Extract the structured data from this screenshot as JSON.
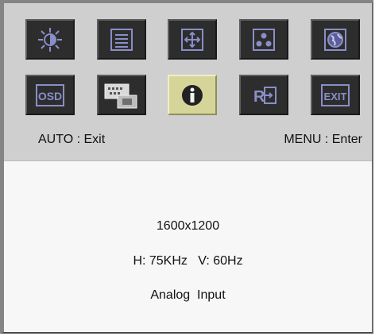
{
  "osd_menu": {
    "icons_row1": [
      {
        "name": "brightness-contrast-icon"
      },
      {
        "name": "list-menu-icon"
      },
      {
        "name": "position-move-icon"
      },
      {
        "name": "color-dots-icon"
      },
      {
        "name": "globe-language-icon"
      }
    ],
    "icons_row2": [
      {
        "name": "osd-settings-icon",
        "label": "OSD"
      },
      {
        "name": "input-signal-icon"
      },
      {
        "name": "information-icon",
        "selected": true
      },
      {
        "name": "reset-recall-icon",
        "label": "R"
      },
      {
        "name": "exit-icon",
        "label": "EXIT"
      }
    ],
    "hints": {
      "left": "AUTO : Exit",
      "right": "MENU : Enter"
    }
  },
  "info_panel": {
    "resolution": "1600x1200",
    "frequency": "H: 75KHz   V: 60Hz",
    "input": "Analog  Input"
  },
  "colors": {
    "icon_background": "#2d2d2d",
    "icon_selected_background": "#d5d59a",
    "icon_glyph": "#7f82c2",
    "top_panel": "#cfcfcf",
    "info_panel": "#f7f7f7"
  }
}
